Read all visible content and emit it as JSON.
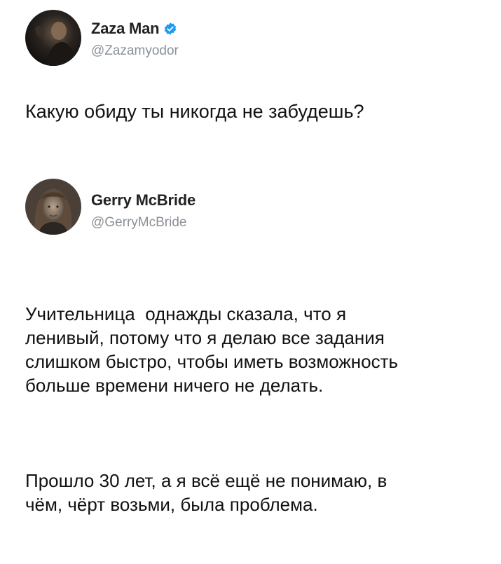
{
  "tweets": [
    {
      "author": {
        "display_name": "Zaza Man",
        "handle": "@Zazamyodor",
        "verified": true,
        "avatar": "avatar-dark-photo"
      },
      "text": "Какую обиду ты никогда не забудешь?"
    },
    {
      "author": {
        "display_name": "Gerry McBride",
        "handle": "@GerryMcBride",
        "verified": false,
        "avatar": "avatar-man-long-hair-photo"
      },
      "paragraphs": [
        "Учительница  однажды сказала, что я\nленивый, потому что я делаю все задания\nслишком быстро, чтобы иметь возможность\nбольше времени ничего не делать.",
        "Прошло 30 лет, а я всё ещё не понимаю, в\nчём, чёрт возьми, была проблема."
      ]
    }
  ],
  "colors": {
    "verified_badge": "#1d9bf0",
    "handle": "#8a9096",
    "text": "#111111"
  }
}
